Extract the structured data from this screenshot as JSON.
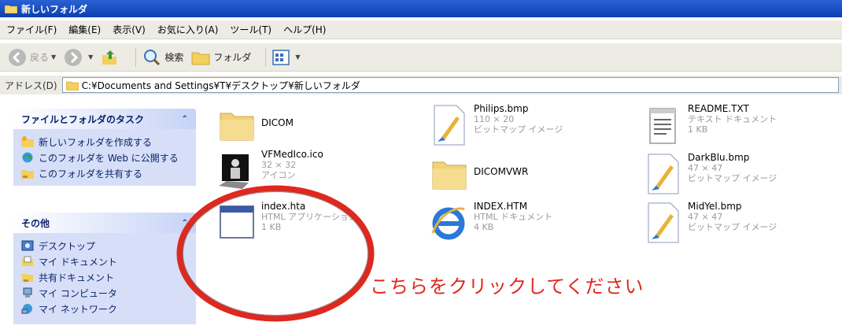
{
  "window": {
    "title": "新しいフォルダ"
  },
  "menu": [
    "ファイル(F)",
    "編集(E)",
    "表示(V)",
    "お気に入り(A)",
    "ツール(T)",
    "ヘルプ(H)"
  ],
  "toolbar": {
    "back": "戻る",
    "search": "検索",
    "folders": "フォルダ"
  },
  "address": {
    "label": "アドレス(D)",
    "value": "C:¥Documents and Settings¥T¥デスクトップ¥新しいフォルダ"
  },
  "tasks_panel": {
    "title": "ファイルとフォルダのタスク",
    "items": [
      "新しいフォルダを作成する",
      "このフォルダを Web に公開する",
      "このフォルダを共有する"
    ]
  },
  "other_panel": {
    "title": "その他",
    "items": [
      "デスクトップ",
      "マイ ドキュメント",
      "共有ドキュメント",
      "マイ コンピュータ",
      "マイ ネットワーク"
    ]
  },
  "files": {
    "dicom": {
      "name": "DICOM"
    },
    "philips": {
      "name": "Philips.bmp",
      "line1": "110 × 20",
      "line2": "ビットマップ イメージ"
    },
    "readme": {
      "name": "README.TXT",
      "line1": "テキスト ドキュメント",
      "line2": "1 KB"
    },
    "vfmed": {
      "name": "VFMedIco.ico",
      "line1": "32 × 32",
      "line2": "アイコン"
    },
    "dicomvwr": {
      "name": "DICOMVWR"
    },
    "darkblu": {
      "name": "DarkBlu.bmp",
      "line1": "47 × 47",
      "line2": "ビットマップ イメージ"
    },
    "index_hta": {
      "name": "index.hta",
      "line1": "HTML アプリケーション",
      "line2": "1 KB"
    },
    "index_htm": {
      "name": "INDEX.HTM",
      "line1": "HTML ドキュメント",
      "line2": "4 KB"
    },
    "midyel": {
      "name": "MidYel.bmp",
      "line1": "47 × 47",
      "line2": "ビットマップ イメージ"
    }
  },
  "callout": {
    "text": "こちらをクリックしてください"
  },
  "colors": {
    "callout_red": "#e0281f",
    "title_blue": "#0a3fb0",
    "panel_blue": "#d6dff7"
  }
}
